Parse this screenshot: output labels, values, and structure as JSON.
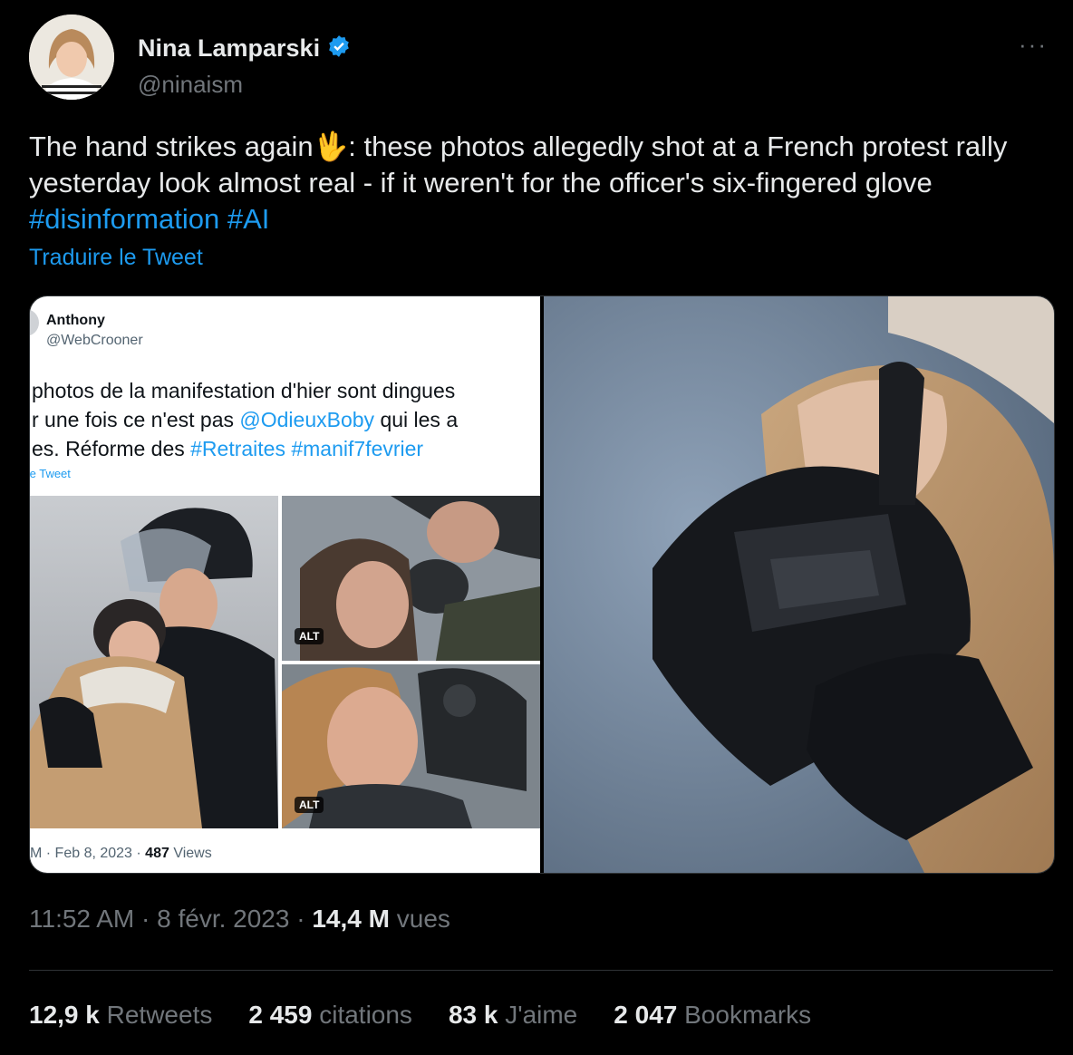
{
  "author": {
    "name": "Nina Lamparski",
    "handle": "@ninaism",
    "verified": true,
    "more_label": "···"
  },
  "tweet": {
    "text_before": "The hand strikes again",
    "emoji": "🖖",
    "text_after": ": these photos allegedly shot at a French protest rally yesterday look almost real - if it weren't for the officer's six-fingered glove",
    "hashtags": [
      "#disinformation",
      "#AI"
    ],
    "translate_label": "Traduire le Tweet"
  },
  "embedded_tweet": {
    "name": "Anthony",
    "handle": "@WebCrooner",
    "line1": "photos de la manifestation d'hier sont dingues",
    "line2_prefix": "r une fois ce n'est pas ",
    "line2_mention": "@OdieuxBoby",
    "line2_suffix": " qui les a",
    "line3_prefix": "es. Réforme des ",
    "line3_tags": "#Retraites #manif7fevrier",
    "translate_label": "te Tweet",
    "alt_label": "ALT",
    "meta_prefix": "M · Feb 8, 2023 · ",
    "views": "487",
    "views_label": " Views"
  },
  "meta": {
    "time": "11:52 AM",
    "date": "8 févr. 2023",
    "views": "14,4 M",
    "views_label": "vues"
  },
  "stats": [
    {
      "value": "12,9 k",
      "label": "Retweets"
    },
    {
      "value": "2 459",
      "label": "citations"
    },
    {
      "value": "83 k",
      "label": "J'aime"
    },
    {
      "value": "2 047",
      "label": "Bookmarks"
    }
  ],
  "colors": {
    "background": "#000000",
    "accent": "#1d9bf0",
    "muted": "#71767b",
    "text": "#e7e9ea"
  }
}
